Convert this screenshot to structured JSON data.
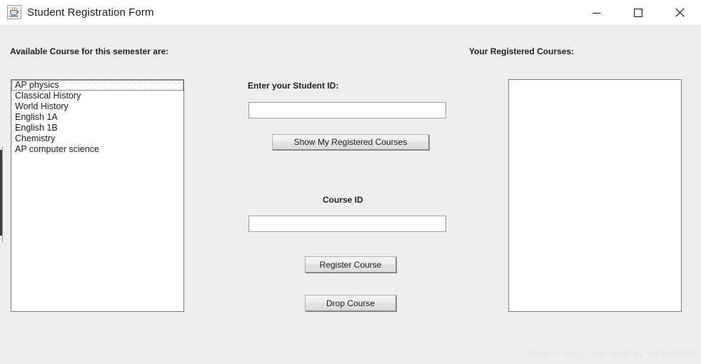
{
  "window": {
    "title": "Student Registration Form",
    "icon": "java-coffee-cup-icon",
    "controls": {
      "minimize_label": "—",
      "maximize_label": "□",
      "close_label": "✕"
    }
  },
  "labels": {
    "available_courses": "Available Course for this semester are:",
    "registered_courses": "Your Registered Courses:",
    "student_id": "Enter your Student ID:",
    "course_id": "Course ID"
  },
  "available_courses": {
    "items": [
      "AP physics",
      "Classical History",
      "World History",
      "English 1A",
      "English 1B",
      "Chemistry",
      "AP computer science"
    ],
    "focused_index": 0
  },
  "registered_courses": {
    "items": []
  },
  "fields": {
    "student_id": {
      "value": "",
      "placeholder": ""
    },
    "course_id": {
      "value": "",
      "placeholder": ""
    }
  },
  "buttons": {
    "show_registered": "Show My Registered Courses",
    "register_course": "Register Course",
    "drop_course": "Drop Course"
  },
  "watermark": "https://blog.csdn.net/qq_42662283",
  "colors": {
    "window_background": "#eeeeee",
    "title_bar": "#ffffff",
    "field_background": "#ffffff",
    "border": "#7a7a7a",
    "text": "#1b1b1b"
  }
}
